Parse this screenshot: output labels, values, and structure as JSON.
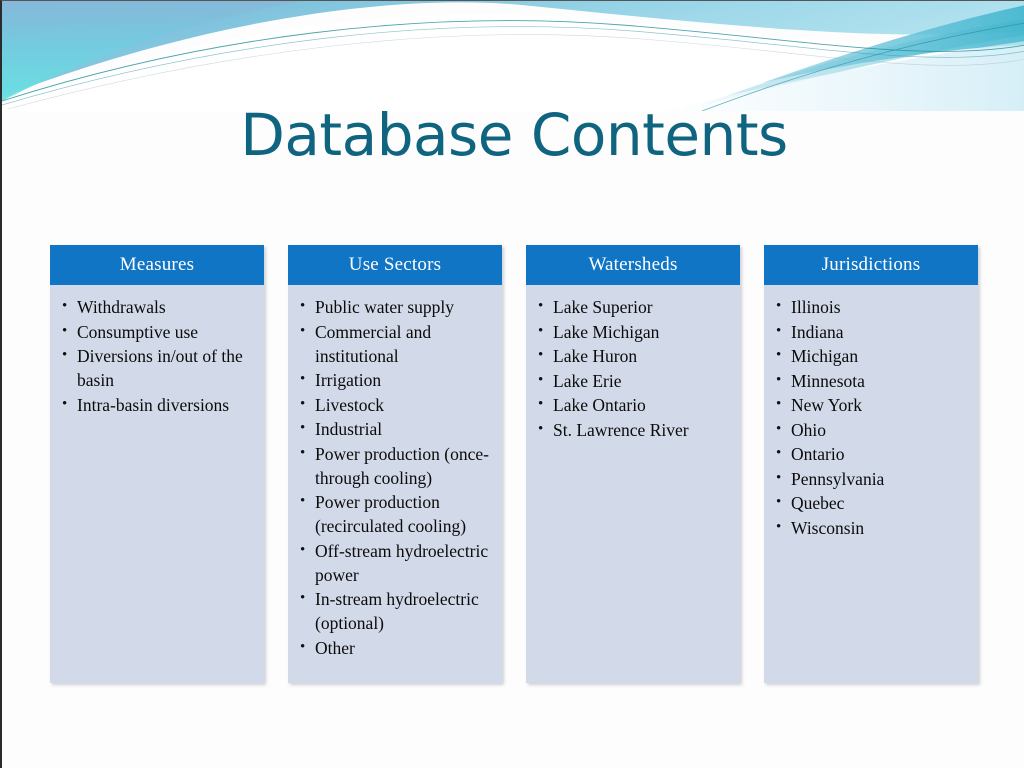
{
  "slide": {
    "title": "Database Contents",
    "title_color": "#0f6480",
    "background_color": "#fdfdfd",
    "header_bar_color": "#1175c6",
    "panel_color": "#d2d9e8",
    "wave_colors": {
      "cyan": "#6fdfe2",
      "sky": "#7fb5d8",
      "light_blue": "#a8d8ec",
      "mid_blue": "#5cbcd8",
      "teal_line": "#1f8f96",
      "pale": "#d8eef7"
    }
  },
  "columns": [
    {
      "header": "Measures",
      "items": [
        "Withdrawals",
        "Consumptive use",
        "Diversions in/out of the basin",
        "Intra-basin diversions"
      ]
    },
    {
      "header": "Use Sectors",
      "items": [
        "Public water supply",
        "Commercial and institutional",
        "Irrigation",
        "Livestock",
        "Industrial",
        "Power production (once-through cooling)",
        "Power production (recirculated cooling)",
        "Off-stream hydroelectric power",
        "In-stream hydroelectric (optional)",
        "Other"
      ]
    },
    {
      "header": "Watersheds",
      "items": [
        "Lake Superior",
        "Lake Michigan",
        "Lake Huron",
        "Lake Erie",
        "Lake Ontario",
        "St. Lawrence River"
      ]
    },
    {
      "header": "Jurisdictions",
      "items": [
        "Illinois",
        "Indiana",
        "Michigan",
        "Minnesota",
        "New York",
        "Ohio",
        "Ontario",
        "Pennsylvania",
        "Quebec",
        "Wisconsin"
      ]
    }
  ]
}
